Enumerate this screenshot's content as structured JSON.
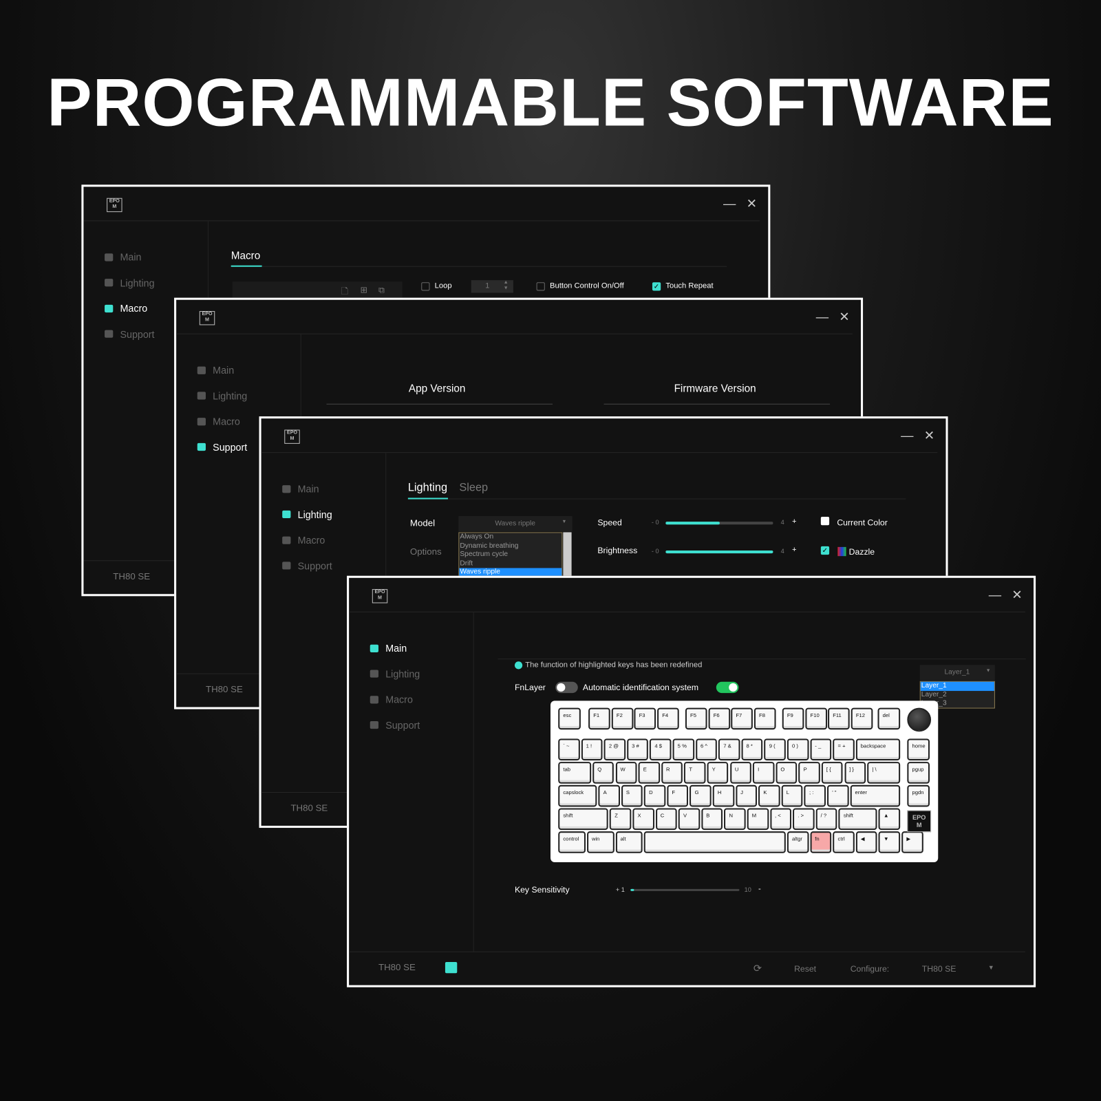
{
  "headline": "PROGRAMMABLE SOFTWARE",
  "logo": "EPOM MAKER",
  "accent": "#3ee0d0",
  "window_controls": {
    "minimize": "—",
    "close": "✕"
  },
  "sidebar": [
    "Main",
    "Lighting",
    "Macro",
    "Support"
  ],
  "device_model": "TH80 SE",
  "macro_window": {
    "tab": "Macro",
    "loop_label": "Loop",
    "loop_count": "1",
    "button_control_label": "Button Control On/Off",
    "touch_repeat_label": "Touch Repeat",
    "touch_repeat_checked": true
  },
  "support_window": {
    "app_version_label": "App Version",
    "firmware_version_label": "Firmware Version"
  },
  "lighting_window": {
    "tabs": [
      "Lighting",
      "Sleep"
    ],
    "model_label": "Model",
    "model_value": "Waves ripple",
    "options_label": "Options",
    "model_options": [
      "Always On",
      "Dynamic breathing",
      "Spectrum cycle",
      "Drift",
      "Waves ripple"
    ],
    "speed": {
      "label": "Speed",
      "min": "- 0",
      "max": "4",
      "plus": "+",
      "value": 2
    },
    "brightness": {
      "label": "Brightness",
      "min": "- 0",
      "max": "4",
      "plus": "+",
      "value": 4
    },
    "current_color_label": "Current Color",
    "current_color_checked": false,
    "dazzle_label": "Dazzle",
    "dazzle_checked": true
  },
  "main_window": {
    "notice": "The function of highlighted keys has been redefined",
    "fnlayer_label": "FnLayer",
    "fnlayer_on": false,
    "auto_id_label": "Automatic identification system",
    "auto_id_on": true,
    "layer_value": "Layer_1",
    "layer_options": [
      "Layer_1",
      "Layer_2",
      "Layer_3"
    ],
    "key_sensitivity": {
      "label": "Key Sensitivity",
      "plus": "+ 1",
      "max": "10",
      "minus": "-",
      "value": 1
    },
    "footer": {
      "reset": "Reset",
      "configure": "Configure:",
      "configure_value": "TH80 SE"
    },
    "highlighted_key": "fn",
    "keyboard": {
      "function_row": [
        "esc",
        "F1",
        "F2",
        "F3",
        "F4",
        "F5",
        "F6",
        "F7",
        "F8",
        "F9",
        "F10",
        "F11",
        "F12",
        "del"
      ],
      "rows": [
        [
          "` ~",
          "1 !",
          "2 @",
          "3 #",
          "4 $",
          "5 %",
          "6 ^",
          "7 &",
          "8 *",
          "9 (",
          "0 )",
          "- _",
          "= +",
          "backspace"
        ],
        [
          "tab",
          "Q",
          "W",
          "E",
          "R",
          "T",
          "Y",
          "U",
          "I",
          "O",
          "P",
          "[ {",
          "] }",
          "| \\"
        ],
        [
          "capslock",
          "A",
          "S",
          "D",
          "F",
          "G",
          "H",
          "J",
          "K",
          "L",
          "; :",
          "' \"",
          "enter"
        ],
        [
          "shift",
          "Z",
          "X",
          "C",
          "V",
          "B",
          "N",
          "M",
          ", <",
          ". >",
          "/ ?",
          "shift",
          "▲"
        ],
        [
          "control",
          "win",
          "alt",
          "",
          "altgr",
          "fn",
          "ctrl",
          "◀",
          "▼",
          "▶"
        ]
      ],
      "nav_column": [
        "home",
        "pgup",
        "pgdn"
      ]
    }
  }
}
